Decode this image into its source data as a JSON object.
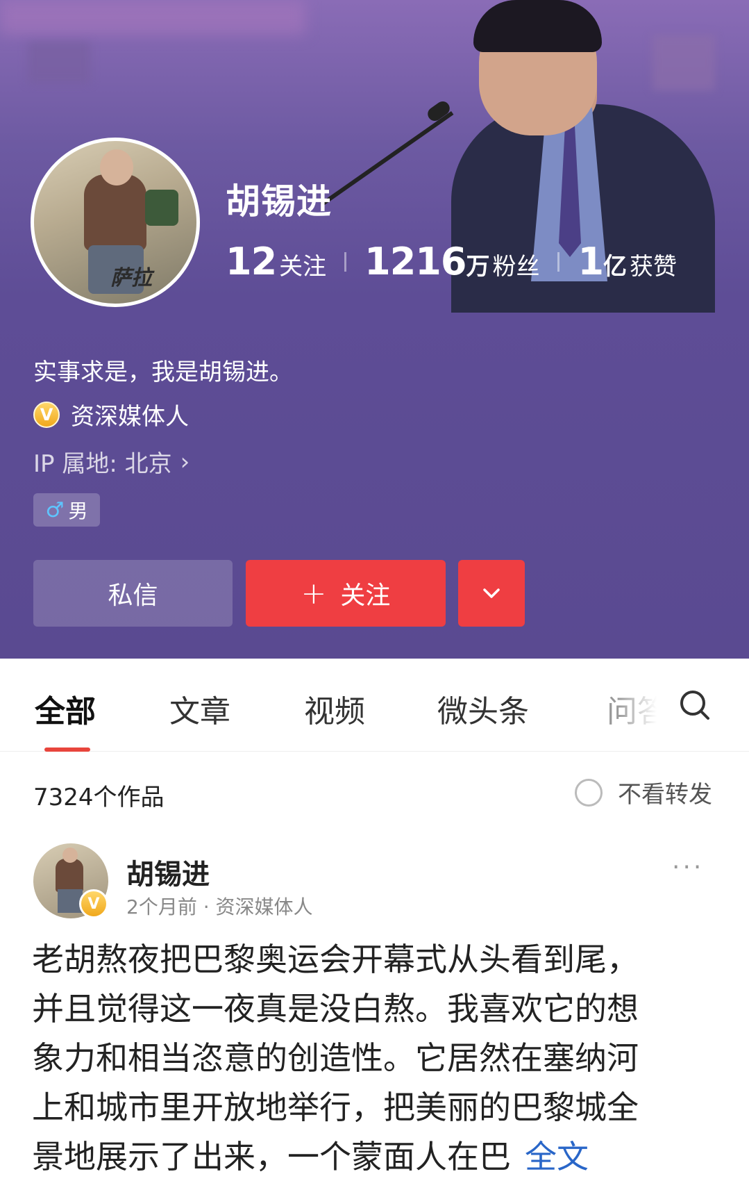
{
  "profile": {
    "name": "胡锡进",
    "avatar_signature": "萨拉",
    "stats": {
      "following_num": "12",
      "following_label": "关注",
      "fans_num": "1216",
      "fans_unit": "万",
      "fans_label": "粉丝",
      "likes_num": "1",
      "likes_unit": "亿",
      "likes_label": "获赞"
    },
    "bio": "实事求是，我是胡锡进。",
    "cert_badge": "V",
    "certification": "资深媒体人",
    "ip_location": "IP 属地: 北京",
    "gender_icon": "♂",
    "gender": "男"
  },
  "actions": {
    "message_label": "私信",
    "follow_plus": "+",
    "follow_label": "关注",
    "more_icon": "chevron-down-icon"
  },
  "tabs": [
    "全部",
    "文章",
    "视频",
    "微头条",
    "问答"
  ],
  "tab_visible_partial": "问答",
  "content": {
    "works_count": "7324个作品",
    "filter_label": "不看转发"
  },
  "post": {
    "author": "胡锡进",
    "verified_badge": "V",
    "meta": "2个月前 · 资深媒体人",
    "menu": "···",
    "lines": [
      "老胡熬夜把巴黎奥运会开幕式从头看到尾，",
      "并且觉得这一夜真是没白熬。我喜欢它的想",
      "象力和相当恣意的创造性。它居然在塞纳河",
      "上和城市里开放地举行，把美丽的巴黎城全",
      "景地展示了出来，一个蒙面人在巴"
    ],
    "more_label": "全文"
  },
  "colors": {
    "header_purple": "#5a4a91",
    "accent_red": "#ef3e42",
    "link_blue": "#2966c8"
  }
}
